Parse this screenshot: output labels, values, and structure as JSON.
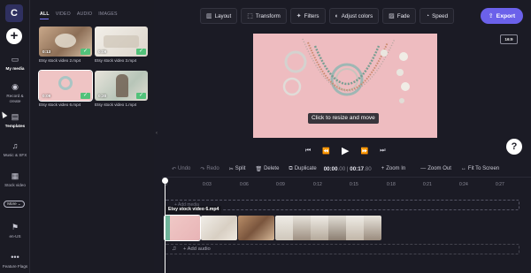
{
  "rail": {
    "logo": "C",
    "items": [
      {
        "label": "My media",
        "icon": "folder-icon"
      },
      {
        "label": "Record & create",
        "icon": "record-icon"
      },
      {
        "label": "Templates",
        "icon": "templates-icon"
      },
      {
        "label": "Music & SFX",
        "icon": "music-icon"
      },
      {
        "label": "Stock video",
        "icon": "film-icon"
      },
      {
        "label": "en-US",
        "icon": "flag-icon"
      },
      {
        "label": "Feature Flags",
        "icon": "dots-icon"
      }
    ],
    "more_label": "More"
  },
  "media": {
    "tabs": [
      "ALL",
      "VIDEO",
      "AUDIO",
      "IMAGES"
    ],
    "active_tab": "ALL",
    "items": [
      {
        "name": "Etsy stock video 2.mp4",
        "duration": "0:13",
        "added": true
      },
      {
        "name": "Etsy stock video 3.mp4",
        "duration": "0:09",
        "added": true
      },
      {
        "name": "Etsy stock video 6.mp4",
        "duration": "0:09",
        "added": true,
        "selected": true
      },
      {
        "name": "Etsy stock video 1.mp4",
        "duration": "0:20",
        "added": true
      }
    ]
  },
  "toolbar": {
    "buttons": [
      {
        "label": "Layout",
        "icon": "layout-icon"
      },
      {
        "label": "Transform",
        "icon": "transform-icon"
      },
      {
        "label": "Filters",
        "icon": "filters-icon"
      },
      {
        "label": "Adjust colors",
        "icon": "adjust-colors-icon"
      },
      {
        "label": "Fade",
        "icon": "fade-icon"
      },
      {
        "label": "Speed",
        "icon": "speed-icon"
      }
    ],
    "export_label": "Export",
    "aspect_ratio": "16:9"
  },
  "preview": {
    "tooltip": "Click to resize and move",
    "background_color": "#eebcc0"
  },
  "timeline": {
    "actions": [
      {
        "label": "Undo",
        "enabled": false
      },
      {
        "label": "Redo",
        "enabled": false
      },
      {
        "label": "Split",
        "enabled": true
      },
      {
        "label": "Delete",
        "enabled": true
      },
      {
        "label": "Duplicate",
        "enabled": true
      }
    ],
    "current_time": "00:00",
    "current_frac": ".00",
    "total_time": "00:17",
    "total_frac": ".80",
    "zoom_in": "Zoom In",
    "zoom_out": "Zoom Out",
    "fit": "Fit To Screen",
    "ticks": [
      "0",
      "0:03",
      "0:06",
      "0:09",
      "0:12",
      "0:15",
      "0:18",
      "0:21",
      "0:24",
      "0:27"
    ],
    "drop_hint": "+ Add media",
    "selected_clip_label": "Etsy stock video 6.mp4",
    "add_audio": "+ Add audio"
  },
  "colors": {
    "accent": "#6b61ea",
    "added_check": "#52c27a"
  }
}
